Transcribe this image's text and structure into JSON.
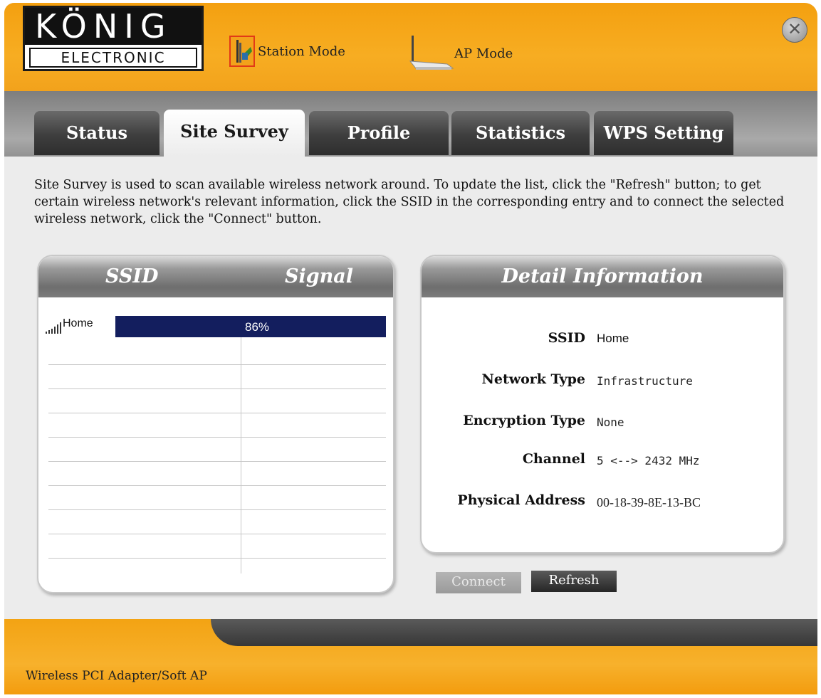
{
  "header": {
    "logo_top": "KÖNIG",
    "logo_bottom": "ELECTRONIC",
    "modes": [
      {
        "label": "Station Mode",
        "icon": "station-adapter-icon",
        "selected": true
      },
      {
        "label": "AP Mode",
        "icon": "access-point-icon",
        "selected": false
      }
    ],
    "close_icon": "close-icon"
  },
  "tabs": [
    {
      "label": "Status",
      "active": false
    },
    {
      "label": "Site Survey",
      "active": true
    },
    {
      "label": "Profile",
      "active": false
    },
    {
      "label": "Statistics",
      "active": false
    },
    {
      "label": "WPS Setting",
      "active": false
    }
  ],
  "description": "Site Survey is used to scan available wireless network around. To update the list, click the \"Refresh\" button; to get certain wireless network's relevant information, click the SSID in the corresponding entry and to connect the selected wireless network, click the \"Connect\" button.",
  "survey": {
    "columns": [
      "SSID",
      "Signal"
    ],
    "rows": [
      {
        "ssid": "Home",
        "signal": "86%",
        "selected": true,
        "icon": "signal-bars-icon"
      }
    ]
  },
  "detail": {
    "title": "Detail Information",
    "fields": [
      {
        "label": "SSID",
        "value": "Home"
      },
      {
        "label": "Network Type",
        "value": "Infrastructure"
      },
      {
        "label": "Encryption Type",
        "value": "None"
      },
      {
        "label": "Channel",
        "value": "5 <--> 2432 MHz"
      },
      {
        "label": "Physical Address",
        "value": "00-18-39-8E-13-BC"
      }
    ]
  },
  "buttons": {
    "connect": {
      "label": "Connect",
      "enabled": false
    },
    "refresh": {
      "label": "Refresh",
      "enabled": true
    }
  },
  "status_bar": "Wireless PCI Adapter/Soft AP",
  "colors": {
    "accent_orange": "#f5a417",
    "selection_navy": "#131e5e",
    "tab_dark": "#3e3e3e"
  }
}
